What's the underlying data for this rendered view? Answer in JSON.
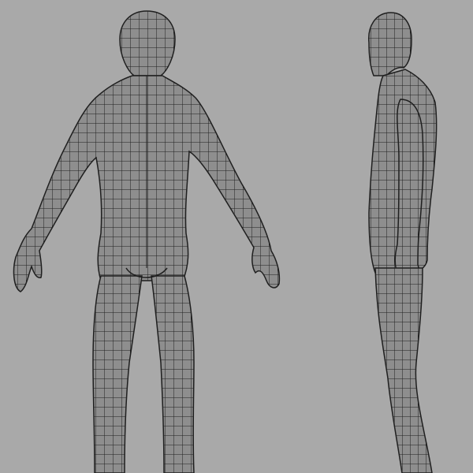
{
  "scene": {
    "background_color": "#a9a9a9",
    "mesh_fill_color": "#8e8e8e",
    "mesh_line_color": "#1f1f1f",
    "views": [
      {
        "name": "front-view",
        "description_icon": "base-mesh-figure-front"
      },
      {
        "name": "side-view",
        "description_icon": "base-mesh-figure-side"
      }
    ]
  }
}
